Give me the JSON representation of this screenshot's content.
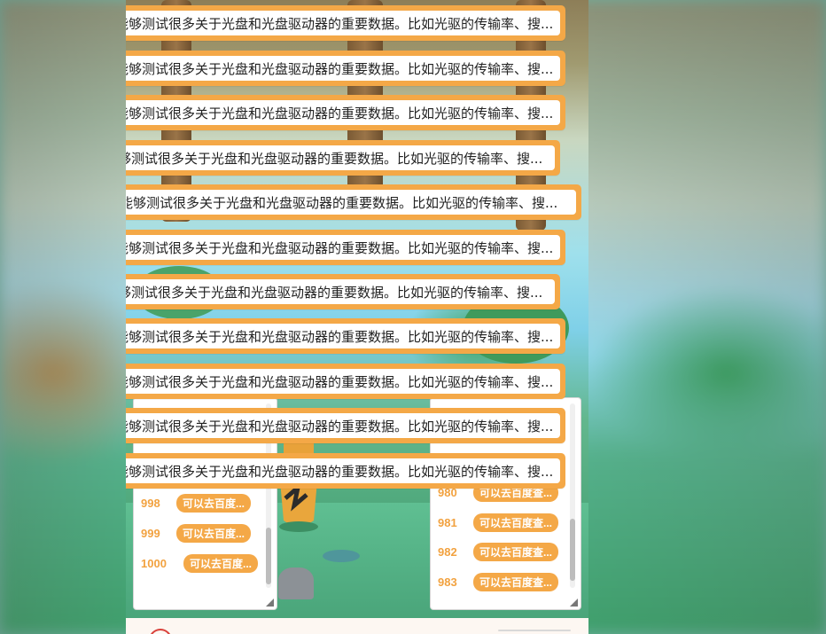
{
  "danmaku": {
    "items": [
      {
        "text": "能够测试很多关于光盘和光盘驱动器的重要数据。比如光驱的传输率、搜..."
      },
      {
        "text": "能够测试很多关于光盘和光盘驱动器的重要数据。比如光驱的传输率、搜..."
      },
      {
        "text": "能够测试很多关于光盘和光盘驱动器的重要数据。比如光驱的传输率、搜..."
      },
      {
        "text": "能够测试很多关于光盘和光盘驱动器的重要数据。比如光驱的传输率、搜..."
      },
      {
        "text": "能够测试很多关于光盘和光盘驱动器的重要数据。比如光驱的传输率、搜..."
      },
      {
        "text": "能够测试很多关于光盘和光盘驱动器的重要数据。比如光驱的传输率、搜..."
      },
      {
        "text": "能够测试很多关于光盘和光盘驱动器的重要数据。比如光驱的传输率、搜..."
      },
      {
        "text": "能够测试很多关于光盘和光盘驱动器的重要数据。比如光驱的传输率、搜..."
      },
      {
        "text": "能够测试很多关于光盘和光盘驱动器的重要数据。比如光驱的传输率、搜..."
      },
      {
        "text": "能够测试很多关于光盘和光盘驱动器的重要数据。比如光驱的传输率、搜..."
      },
      {
        "text": "能够测试很多关于光盘和光盘驱动器的重要数据。比如光驱的传输率、搜..."
      }
    ]
  },
  "left_panel": {
    "rows": [
      {
        "num": "998",
        "label": "可以去百度..."
      },
      {
        "num": "999",
        "label": "可以去百度..."
      },
      {
        "num": "1000",
        "label": "可以去百度..."
      }
    ]
  },
  "right_panel": {
    "rows": [
      {
        "num": "980",
        "label": "可以去百度查..."
      },
      {
        "num": "981",
        "label": "可以去百度查..."
      },
      {
        "num": "982",
        "label": "可以去百度查..."
      },
      {
        "num": "983",
        "label": "可以去百度查..."
      }
    ]
  },
  "colors": {
    "accent": "#f4a847",
    "bar_text": "#222222",
    "number_text": "#f2a240"
  },
  "icons": [
    "resize-handle-icon",
    "app-logo-icon"
  ]
}
